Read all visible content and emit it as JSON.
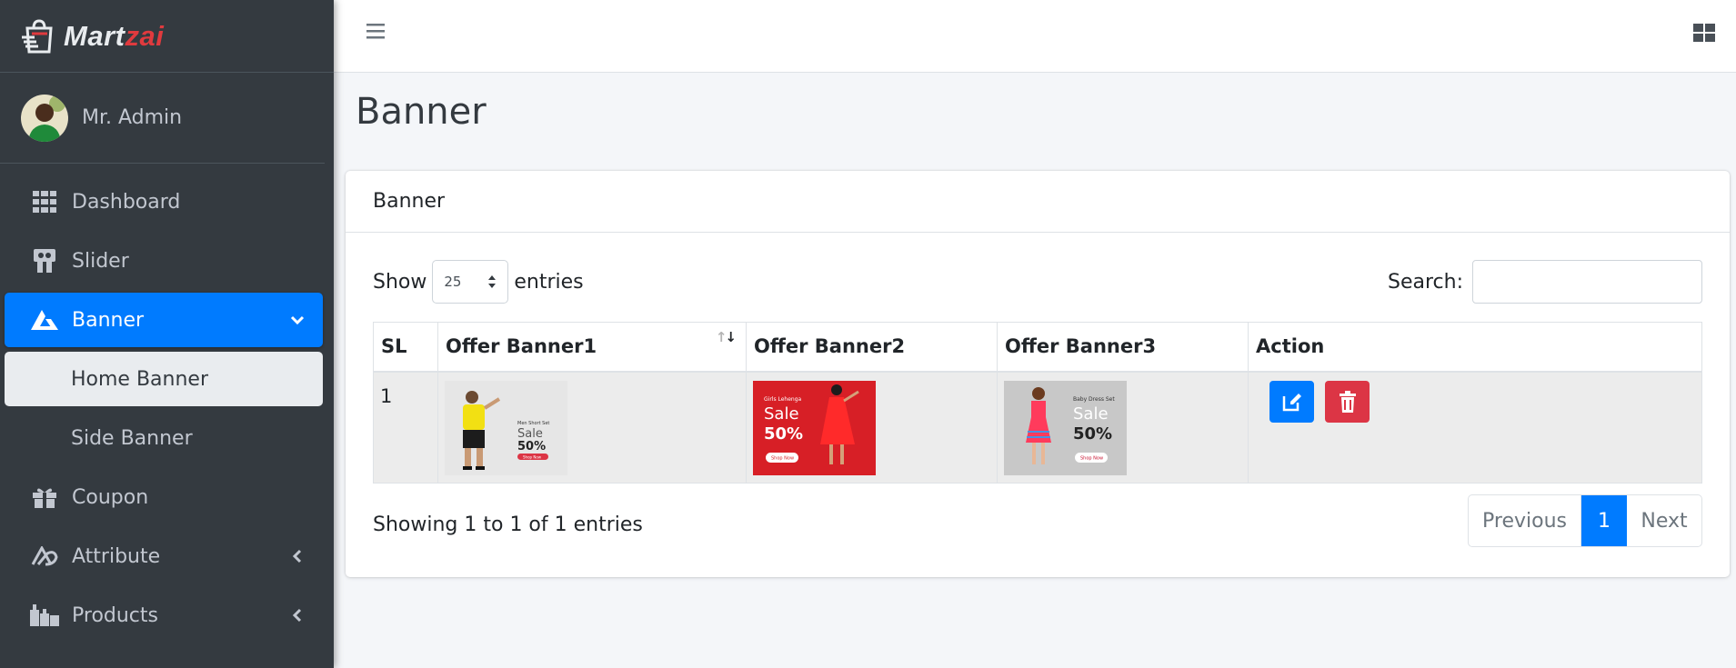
{
  "brand": {
    "name_part1": "Mart",
    "name_part2": "zai"
  },
  "user": {
    "name": "Mr. Admin"
  },
  "sidebar": {
    "items": [
      {
        "label": "Dashboard",
        "icon": "grid-icon"
      },
      {
        "label": "Slider",
        "icon": "slideshare-icon"
      },
      {
        "label": "Banner",
        "icon": "banner-icon",
        "active": true,
        "expanded": true
      },
      {
        "label": "Coupon",
        "icon": "gift-icon"
      },
      {
        "label": "Attribute",
        "icon": "attribute-icon"
      },
      {
        "label": "Products",
        "icon": "products-icon"
      }
    ],
    "subitems": [
      {
        "label": "Home Banner",
        "current": true
      },
      {
        "label": "Side Banner"
      }
    ]
  },
  "page": {
    "title": "Banner"
  },
  "card": {
    "title": "Banner"
  },
  "table_controls": {
    "show_label": "Show",
    "entries_value": "25",
    "entries_label": "entries",
    "search_label": "Search:",
    "search_value": ""
  },
  "table": {
    "columns": [
      "SL",
      "Offer Banner1",
      "Offer Banner2",
      "Offer Banner3",
      "Action"
    ],
    "rows": [
      {
        "sl": "1",
        "banner1": {
          "caption": "Men Short Set",
          "sale": "Sale",
          "percent": "50%",
          "cta": "Shop Now"
        },
        "banner2": {
          "caption": "Girls Lehenga",
          "sale": "Sale",
          "percent": "50%",
          "cta": "Shop Now"
        },
        "banner3": {
          "caption": "Baby Dress Set",
          "sale": "Sale",
          "percent": "50%",
          "cta": "Shop Now"
        }
      }
    ]
  },
  "footer": {
    "showing_text": "Showing 1 to 1 of 1 entries",
    "prev_label": "Previous",
    "current_page": "1",
    "next_label": "Next"
  },
  "colors": {
    "sidebar_bg": "#343a40",
    "accent": "#007bff",
    "danger": "#dc3545",
    "brand_red": "#e03a3e"
  }
}
